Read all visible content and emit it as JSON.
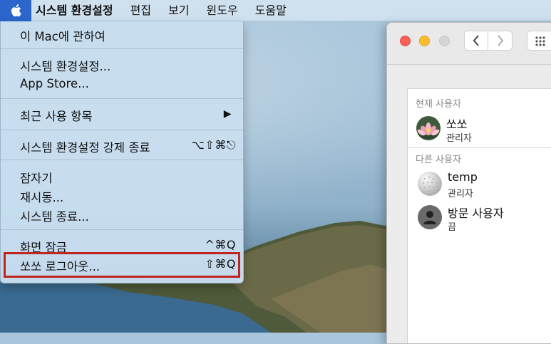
{
  "menubar": {
    "app_name": "시스템 환경설정",
    "items": [
      "편집",
      "보기",
      "윈도우",
      "도움말"
    ]
  },
  "apple_menu": {
    "about": "이 Mac에 관하여",
    "system_prefs": "시스템 환경설정...",
    "app_store": "App Store...",
    "recent_items": "최근 사용 항목",
    "force_quit": "시스템 환경설정 강제 종료",
    "force_quit_shortcut": "⌥⇧⌘⎋",
    "sleep": "잠자기",
    "restart": "재시동...",
    "shutdown": "시스템 종료...",
    "lock_screen": "화면 잠금",
    "lock_screen_shortcut": "^⌘Q",
    "logout": "쏘쏘 로그아웃...",
    "logout_shortcut": "⇧⌘Q"
  },
  "users_panel": {
    "current_user_header": "현재 사용자",
    "current_user": {
      "name": "쏘쏘",
      "role": "관리자",
      "avatar_icon": "lotus-avatar-icon"
    },
    "other_users_header": "다른 사용자",
    "other_users": [
      {
        "name": "temp",
        "role": "관리자",
        "avatar_icon": "golf-ball-avatar-icon"
      },
      {
        "name": "방문 사용자",
        "role": "끔",
        "avatar_icon": "person-silhouette-icon"
      }
    ]
  },
  "colors": {
    "highlight_border": "#c0261f",
    "menu_bg": "#c8def0"
  }
}
